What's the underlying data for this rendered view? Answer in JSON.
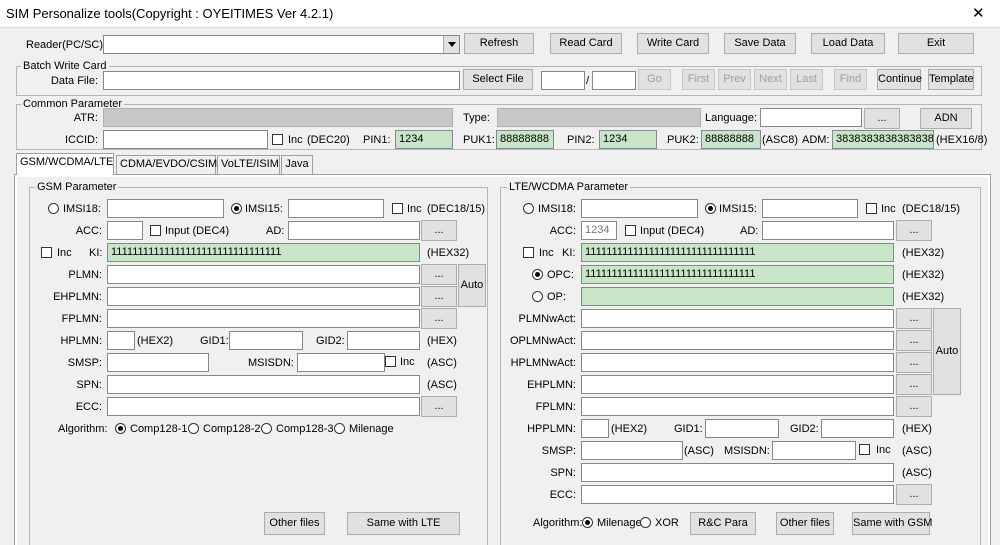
{
  "window": {
    "title": "SIM Personalize tools(Copyright : OYEITIMES Ver 4.2.1)",
    "close_glyph": "✕"
  },
  "toolbar": {
    "reader_label": "Reader(PC/SC):",
    "reader_value": "",
    "refresh": "Refresh",
    "read_card": "Read Card",
    "write_card": "Write Card",
    "save_data": "Save Data",
    "load_data": "Load Data",
    "exit": "Exit"
  },
  "batch": {
    "title": "Batch Write Card",
    "data_file_label": "Data File:",
    "data_file_value": "",
    "select_file": "Select File",
    "range_from": "",
    "range_sep": "/",
    "range_to": "",
    "go": "Go",
    "first": "First",
    "prev": "Prev",
    "next": "Next",
    "last": "Last",
    "find": "Find",
    "continue": "Continue",
    "template": "Template"
  },
  "common": {
    "title": "Common Parameter",
    "atr_label": "ATR:",
    "type_label": "Type:",
    "language_label": "Language:",
    "language_btn": "...",
    "adn": "ADN",
    "iccid_label": "ICCID:",
    "iccid_value": "",
    "inc_label": "Inc",
    "iccid_hint": "(DEC20)",
    "pin1_label": "PIN1:",
    "pin1": "1234",
    "puk1_label": "PUK1:",
    "puk1": "88888888",
    "pin2_label": "PIN2:",
    "pin2": "1234",
    "puk2_label": "PUK2:",
    "puk2": "88888888",
    "puk2_hint": "(ASC8)",
    "adm_label": "ADM:",
    "adm": "3838383838383838",
    "adm_hint": "(HEX16/8)"
  },
  "tabs": [
    "GSM/WCDMA/LTE",
    "CDMA/EVDO/CSIM",
    "VoLTE/ISIM",
    "Java"
  ],
  "gsm": {
    "title": "GSM Parameter",
    "imsi18": "IMSI18:",
    "imsi15": "IMSI15:",
    "inc": "Inc",
    "imsi_hint": "(DEC18/15)",
    "acc": "ACC:",
    "input": "Input (DEC4)",
    "ad": "AD:",
    "ki_inc": "Inc",
    "ki": "KI:",
    "ki_value": "11111111111111111111111111111111",
    "hex32": "(HEX32)",
    "plmn": "PLMN:",
    "ehplmn": "EHPLMN:",
    "fplmn": "FPLMN:",
    "auto": "Auto",
    "hplmn": "HPLMN:",
    "hex2": "(HEX2)",
    "gid1": "GID1:",
    "gid2": "GID2:",
    "hex": "(HEX)",
    "smsp": "SMSP:",
    "msisdn": "MSISDN:",
    "msisdn_inc": "Inc",
    "asc": "(ASC)",
    "spn": "SPN:",
    "spn_hint": "(ASC)",
    "ecc": "ECC:",
    "algorithm": "Algorithm:",
    "alg": [
      "Comp128-1",
      "Comp128-2",
      "Comp128-3",
      "Milenage"
    ],
    "other_files": "Other files",
    "same_with": "Same with LTE",
    "dots": "..."
  },
  "lte": {
    "title": "LTE/WCDMA Parameter",
    "imsi18": "IMSI18:",
    "imsi15": "IMSI15:",
    "inc": "Inc",
    "imsi_hint": "(DEC18/15)",
    "acc": "ACC:",
    "acc_value": "1234",
    "input": "Input (DEC4)",
    "ad": "AD:",
    "ki_inc": "Inc",
    "ki": "KI:",
    "ki_value": "11111111111111111111111111111111",
    "ki_hint": "(HEX32)",
    "opc": "OPC:",
    "opc_value": "11111111111111111111111111111111",
    "opc_hint": "(HEX32)",
    "op": "OP:",
    "op_hint": "(HEX32)",
    "plmnwact": "PLMNwAct:",
    "oplmnwact": "OPLMNwAct:",
    "hplmnwact": "HPLMNwAct:",
    "ehplmn": "EHPLMN:",
    "fplmn": "FPLMN:",
    "auto": "Auto",
    "hpplmn": "HPPLMN:",
    "hex2": "(HEX2)",
    "gid1": "GID1:",
    "gid2": "GID2:",
    "hex": "(HEX)",
    "smsp": "SMSP:",
    "smsp_hint": "(ASC)",
    "msisdn": "MSISDN:",
    "msisdn_inc": "Inc",
    "msisdn_hint": "(ASC)",
    "spn": "SPN:",
    "spn_hint": "(ASC)",
    "ecc": "ECC:",
    "algorithm": "Algorithm:",
    "alg": [
      "Milenage",
      "XOR"
    ],
    "rc_para": "R&C Para",
    "other_files": "Other files",
    "same_with": "Same with GSM",
    "dots": "..."
  }
}
